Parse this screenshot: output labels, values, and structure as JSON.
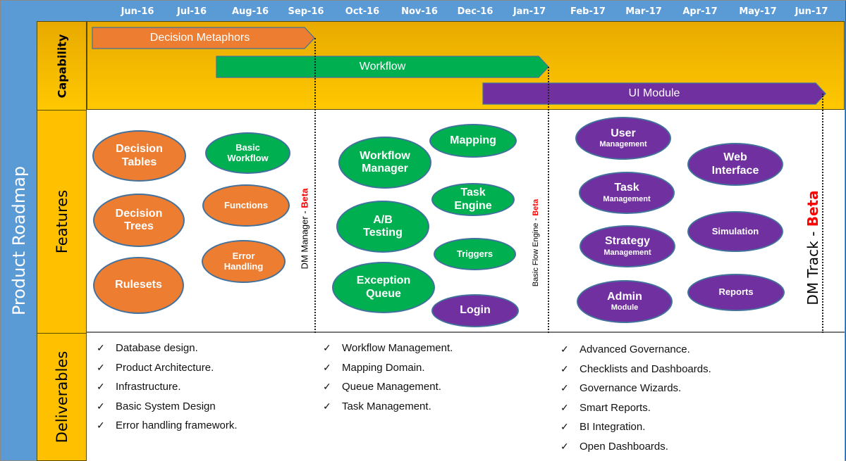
{
  "title": "Product Roadmap",
  "timeline": [
    "Jun-16",
    "Jul-16",
    "Aug-16",
    "Sep-16",
    "Oct-16",
    "Nov-16",
    "Dec-16",
    "Jan-17",
    "Feb-17",
    "Mar-17",
    "Apr-17",
    "May-17",
    "Jun-17"
  ],
  "lanes": {
    "capability": "Capability",
    "features": "Features",
    "deliverables": "Deliverables"
  },
  "capabilities": [
    {
      "label": "Decision Metaphors",
      "color": "#ed7d31",
      "start": "Jun-16",
      "end": "Sep-16"
    },
    {
      "label": "Workflow",
      "color": "#00b050",
      "start": "Aug-16",
      "end": "Jan-17"
    },
    {
      "label": "UI Module",
      "color": "#7030a0",
      "start": "Dec-16",
      "end": "Jun-17"
    }
  ],
  "milestones": [
    {
      "name": "DM Manager",
      "suffix": " - ",
      "status": "Beta"
    },
    {
      "name": "Basic Flow Engine",
      "suffix": " - ",
      "status": "Beta"
    },
    {
      "name": "DM Track",
      "suffix": " - ",
      "status": "Beta"
    }
  ],
  "features": {
    "phase1": [
      {
        "line1": "Decision",
        "line2": "Tables",
        "color": "orange"
      },
      {
        "line1": "Decision",
        "line2": "Trees",
        "color": "orange"
      },
      {
        "line1": "Rulesets",
        "line2": "",
        "color": "orange"
      },
      {
        "line1": "Basic",
        "line2": "Workflow",
        "color": "green"
      },
      {
        "line1": "Functions",
        "line2": "",
        "color": "orange"
      },
      {
        "line1": "Error",
        "line2": "Handling",
        "color": "orange"
      }
    ],
    "phase2": [
      {
        "line1": "Workflow",
        "line2": "Manager",
        "color": "green"
      },
      {
        "line1": "A/B",
        "line2": "Testing",
        "color": "green"
      },
      {
        "line1": "Exception",
        "line2": "Queue",
        "color": "green"
      },
      {
        "line1": "Mapping",
        "line2": "",
        "color": "green"
      },
      {
        "line1": "Task",
        "line2": "Engine",
        "color": "green"
      },
      {
        "line1": "Triggers",
        "line2": "",
        "color": "green"
      },
      {
        "line1": "Login",
        "line2": "",
        "color": "purple"
      }
    ],
    "phase3": [
      {
        "line1": "User",
        "line2": "Management",
        "color": "purple"
      },
      {
        "line1": "Task",
        "line2": "Management",
        "color": "purple"
      },
      {
        "line1": "Strategy",
        "line2": "Management",
        "color": "purple"
      },
      {
        "line1": "Admin",
        "line2": "Module",
        "color": "purple"
      },
      {
        "line1": "Web",
        "line2": "Interface",
        "color": "purple"
      },
      {
        "line1": "Simulation",
        "line2": "",
        "color": "purple"
      },
      {
        "line1": "Reports",
        "line2": "",
        "color": "purple"
      }
    ]
  },
  "deliverables": {
    "check": "✓",
    "phase1": [
      "Database design.",
      "Product Architecture.",
      "Infrastructure.",
      "Basic System Design",
      "Error handling framework."
    ],
    "phase2": [
      "Workflow Management.",
      "Mapping Domain.",
      "Queue Management.",
      "Task Management."
    ],
    "phase3": [
      "Advanced Governance.",
      "Checklists and Dashboards.",
      "Governance Wizards.",
      "Smart Reports.",
      "BI Integration.",
      "Open Dashboards."
    ]
  }
}
